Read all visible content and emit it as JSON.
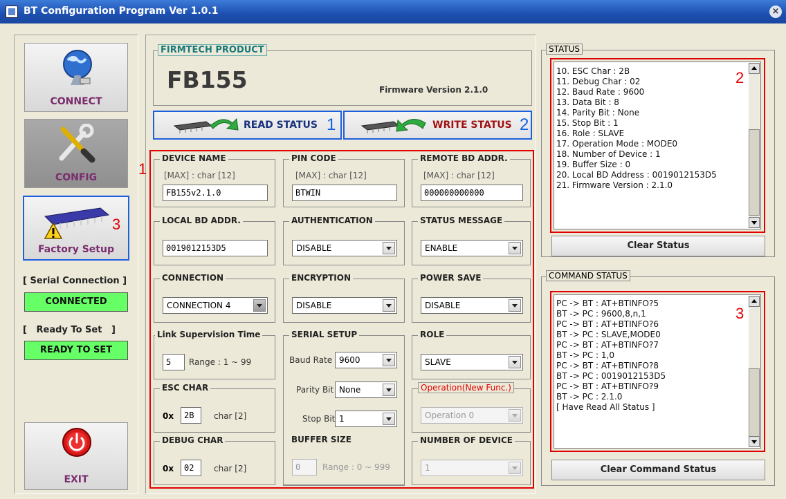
{
  "window": {
    "title": "BT Configuration Program Ver 1.0.1",
    "close": "×"
  },
  "nav": {
    "connect": "CONNECT",
    "config": "CONFIG",
    "factory": "Factory Setup",
    "exit": "EXIT"
  },
  "annot": {
    "n1": "1",
    "n2": "2",
    "n3": "3"
  },
  "sidebar": {
    "serial_label": "[ Serial Connection ]",
    "serial_value": "CONNECTED",
    "ready_label": "[   Ready To Set   ]",
    "ready_value": "READY TO SET"
  },
  "product": {
    "group_title": "FIRMTECH PRODUCT",
    "model": "FB155",
    "firmware": "Firmware Version  2.1.0"
  },
  "actions": {
    "read": "READ STATUS",
    "write": "WRITE STATUS"
  },
  "fields": {
    "device_name": {
      "title": "DEVICE NAME",
      "max": "[MAX] : char [12]",
      "value": "FB155v2.1.0"
    },
    "pin_code": {
      "title": "PIN CODE",
      "max": "[MAX] : char [12]",
      "value": "BTWIN"
    },
    "remote_bd": {
      "title": "REMOTE BD ADDR.",
      "max": "[MAX] : char [12]",
      "value": "000000000000"
    },
    "local_bd": {
      "title": "LOCAL BD ADDR.",
      "value": "0019012153D5"
    },
    "authentication": {
      "title": "AUTHENTICATION",
      "value": "DISABLE"
    },
    "status_message": {
      "title": "STATUS MESSAGE",
      "value": "ENABLE"
    },
    "connection": {
      "title": "CONNECTION",
      "value": "CONNECTION 4"
    },
    "encryption": {
      "title": "ENCRYPTION",
      "value": "DISABLE"
    },
    "power_save": {
      "title": "POWER SAVE",
      "value": "DISABLE"
    },
    "link": {
      "title": "Link Supervision Time",
      "value": "5",
      "range": "Range : 1 ~ 99"
    },
    "serial": {
      "title": "SERIAL SETUP",
      "baud_label": "Baud Rate",
      "baud": "9600",
      "parity_label": "Parity Bit",
      "parity": "None",
      "stop_label": "Stop Bit",
      "stop": "1"
    },
    "role": {
      "title": "ROLE",
      "value": "SLAVE"
    },
    "esc": {
      "title": "ESC CHAR",
      "prefix": "0x",
      "value": "2B",
      "suffix": "char [2]"
    },
    "operation": {
      "title": "Operation(New Func.)",
      "value": "Operation 0"
    },
    "debug": {
      "title": "DEBUG CHAR",
      "prefix": "0x",
      "value": "02",
      "suffix": "char [2]"
    },
    "buffer": {
      "title": "BUFFER SIZE",
      "value": "0",
      "range": "Range : 0 ~ 999"
    },
    "num_device": {
      "title": "NUMBER OF DEVICE",
      "value": "1"
    }
  },
  "status": {
    "title": "STATUS",
    "lines": [
      "10. ESC Char : 2B",
      "11. Debug Char : 02",
      "12. Baud Rate : 9600",
      "13. Data Bit : 8",
      "14. Parity Bit : None",
      "15. Stop Bit : 1",
      "16. Role : SLAVE",
      "17. Operation Mode : MODE0",
      "18. Number of Device : 1",
      "19. Buffer Size : 0",
      "20. Local BD Address : 0019012153D5",
      "21. Firmware Version : 2.1.0"
    ],
    "clear": "Clear Status"
  },
  "command": {
    "title": "COMMAND STATUS",
    "lines": [
      "PC -> BT : AT+BTINFO?5",
      "BT -> PC : 9600,8,n,1",
      "PC -> BT : AT+BTINFO?6",
      "BT -> PC : SLAVE,MODE0",
      "PC -> BT : AT+BTINFO?7",
      "BT -> PC : 1,0",
      "PC -> BT : AT+BTINFO?8",
      "BT -> PC : 0019012153D5",
      "PC -> BT : AT+BTINFO?9",
      "BT -> PC : 2.1.0",
      "[ Have Read All Status ]"
    ],
    "clear": "Clear Command Status"
  },
  "colors": {
    "red_box": "#e00000",
    "blue_box": "#1e5fe0",
    "green": "#66ff66"
  }
}
